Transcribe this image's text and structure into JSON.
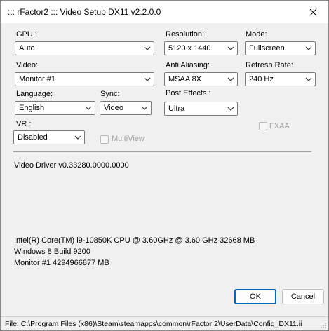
{
  "window": {
    "title": "::: rFactor2 ::: Video Setup DX11 v2.2.0.0"
  },
  "fields": {
    "gpu": {
      "label": "GPU :",
      "value": "Auto"
    },
    "resolution": {
      "label": "Resolution:",
      "value": "5120 x 1440"
    },
    "mode": {
      "label": "Mode:",
      "value": "Fullscreen"
    },
    "video": {
      "label": "Video:",
      "value": "Monitor #1"
    },
    "anti_aliasing": {
      "label": "Anti Aliasing:",
      "value": "MSAA 8X"
    },
    "refresh_rate": {
      "label": "Refresh Rate:",
      "value": "240 Hz"
    },
    "language": {
      "label": "Language:",
      "value": "English"
    },
    "sync": {
      "label": "Sync:",
      "value": "Video"
    },
    "post_effects": {
      "label": "Post Effects :",
      "value": "Ultra"
    },
    "vr": {
      "label": "VR :",
      "value": "Disabled"
    }
  },
  "checkboxes": {
    "fxaa": {
      "label": "FXAA",
      "checked": false,
      "enabled": false
    },
    "multiview": {
      "label": "MultiView",
      "checked": false,
      "enabled": false
    }
  },
  "info": {
    "driver": "Video Driver v0.33280.0000.0000",
    "cpu": "Intel(R) Core(TM) i9-10850K CPU @ 3.60GHz @ 3.60 GHz 32668 MB",
    "os": "Windows 8 Build 9200",
    "monitor": "Monitor #1 4294966877 MB"
  },
  "buttons": {
    "ok": "OK",
    "cancel": "Cancel"
  },
  "status": {
    "file": "File:  C:\\Program Files (x86)\\Steam\\steamapps\\common\\rFactor 2\\UserData\\Config_DX11.ii"
  },
  "icons": {
    "close": "close-icon",
    "dropdown": "chevron-down-icon",
    "grip": "resize-grip-icon"
  },
  "colors": {
    "accent": "#0067c0",
    "separator": "#a0a0a0",
    "disabled_text": "#a0a0a0"
  }
}
